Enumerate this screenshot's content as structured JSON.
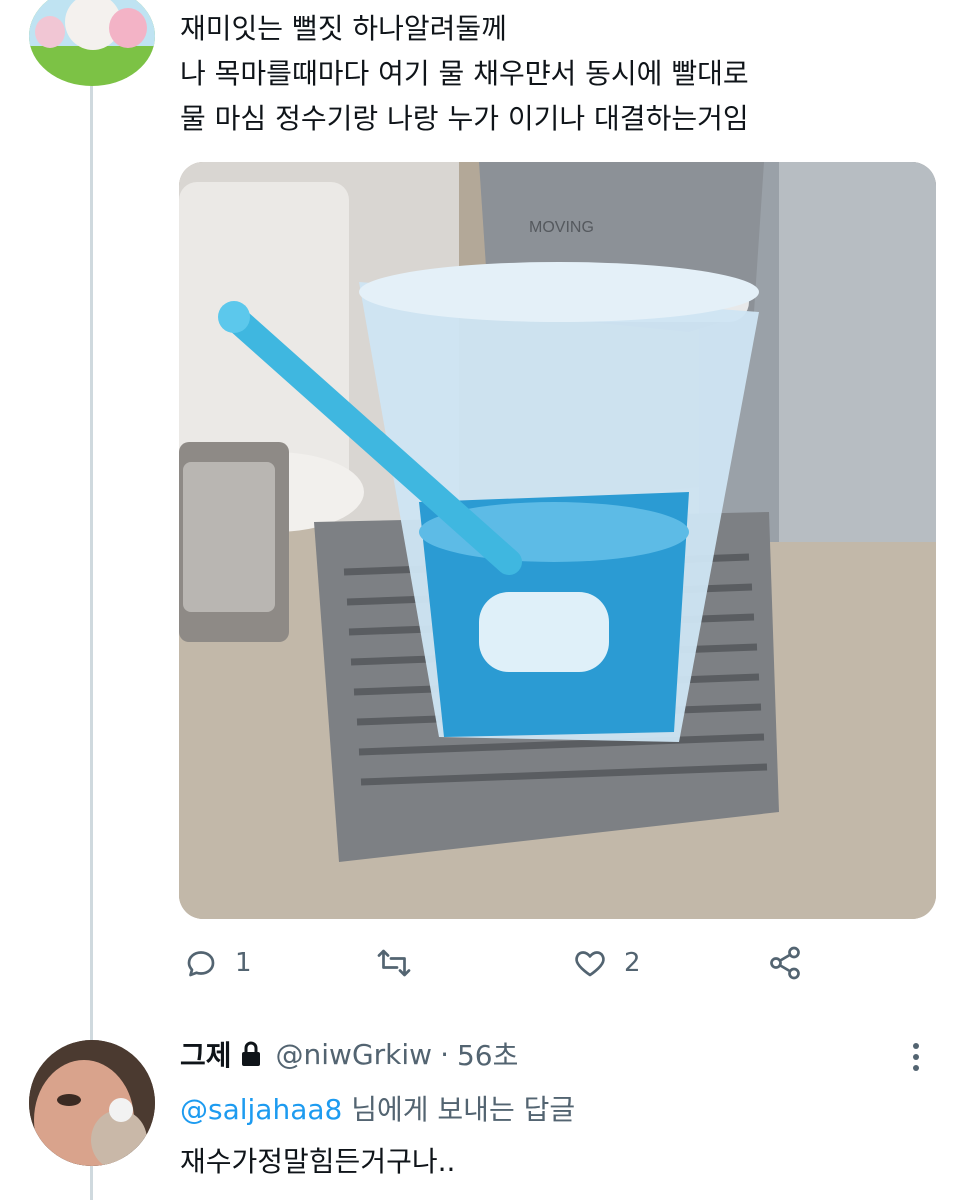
{
  "tweet": {
    "lines": [
      "재미잇는 뻘짓 하나알려둘께",
      "나 목마를때마다 여기 물 채우먄서 동시에 빨대로",
      "물 마심 정수기랑 나랑 누가 이기나 대결하는거임"
    ],
    "photo_text": "MOVING",
    "reply_count": "1",
    "retweet_count": "",
    "like_count": "2"
  },
  "reply": {
    "name": "그제",
    "handle": "@niwGrkiw",
    "separator": "·",
    "time": "56초",
    "replying_mention": "@saljahaa8",
    "replying_suffix": " 님에게 보내는 답글",
    "text": "재수가정말힘든거구나.."
  },
  "icons": {
    "reply": "reply-icon",
    "retweet": "retweet-icon",
    "like": "heart-icon",
    "share": "share-icon",
    "lock": "lock-icon",
    "more": "more-icon"
  },
  "colors": {
    "muted": "#536471",
    "link": "#1d9bf0",
    "text": "#0f1419",
    "thread": "#cfd9de"
  }
}
